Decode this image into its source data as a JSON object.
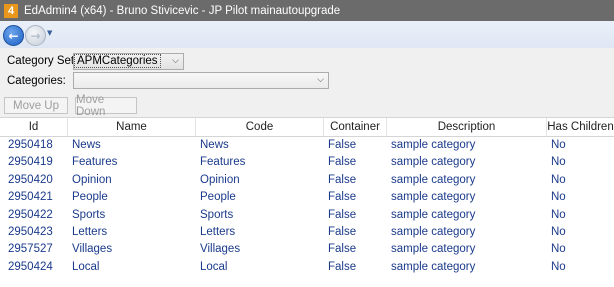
{
  "window": {
    "title": "EdAdmin4 (x64) - Bruno Stivicevic - JP Pilot mainautoupgrade",
    "app_icon_glyph": "4"
  },
  "nav": {
    "back_icon": "arrow-left-icon",
    "forward_icon": "arrow-right-icon",
    "history_icon": "chevron-down-icon"
  },
  "filters": {
    "category_sets_label": "Category Sets:",
    "category_sets_value": "APMCategories",
    "categories_label": "Categories:",
    "categories_value": ""
  },
  "buttons": {
    "move_up": "Move Up",
    "move_down": "Move Down"
  },
  "table": {
    "columns": [
      "Id",
      "Name",
      "Code",
      "Container",
      "Description",
      "Has Children"
    ],
    "rows": [
      [
        "2950418",
        "News",
        "News",
        "False",
        "sample category",
        "No"
      ],
      [
        "2950419",
        "Features",
        "Features",
        "False",
        "sample category",
        "No"
      ],
      [
        "2950420",
        "Opinion",
        "Opinion",
        "False",
        "sample category",
        "No"
      ],
      [
        "2950421",
        "People",
        "People",
        "False",
        "sample category",
        "No"
      ],
      [
        "2950422",
        "Sports",
        "Sports",
        "False",
        "sample category",
        "No"
      ],
      [
        "2950423",
        "Letters",
        "Letters",
        "False",
        "sample category",
        "No"
      ],
      [
        "2957527",
        "Villages",
        "Villages",
        "False",
        "sample category",
        "No"
      ],
      [
        "2950424",
        "Local",
        "Local",
        "False",
        "sample category",
        "No"
      ]
    ]
  },
  "colors": {
    "titlebar": "#6b6b6b",
    "cell_text": "#1a3a8a",
    "panel": "#f0f0f0"
  }
}
